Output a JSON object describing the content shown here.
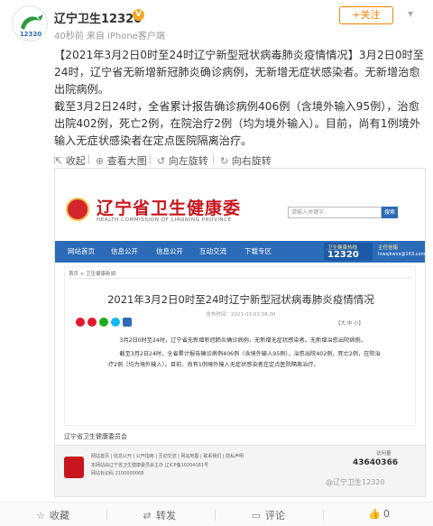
{
  "post": {
    "author": "辽宁卫生12320",
    "verified_mark": "V",
    "meta": "40秒前 来自 iPhone客户端",
    "follow_label": "+关注",
    "more_icon": "chevron-down-icon",
    "text_paragraph_1": "【2021年3月2日0时至24时辽宁新型冠状病毒肺炎疫情情况】3月2日0时至24时，辽宁省无新增新冠肺炎确诊病例，无新增无症状感染者。无新增治愈出院病例。",
    "text_paragraph_2": "截至3月2日24时，全省累计报告确诊病例406例（含境外输入95例），治愈出院402例，死亡2例，在院治疗2例（均为境外输入）。目前，尚有1例境外输入无症状感染者在定点医院隔离治疗。"
  },
  "image_toolbar": {
    "collapse": "收起",
    "view_large": "查看大图",
    "rotate_left": "向左旋转",
    "rotate_right": "向右旋转"
  },
  "screenshot": {
    "avatar_label": "12320",
    "site_title": "辽宁省卫生健康委",
    "site_subtitle": "HEALTH COMMISSION OF LIAONING PROVINCE",
    "search_placeholder": "请输入关键字",
    "search_button": "搜索",
    "nav": [
      "网站首页",
      "信息公开",
      "信息公开",
      "互动交流",
      "下载专区"
    ],
    "hotline_label": "卫生健康热线",
    "hotline_number": "12320",
    "mailbox_label": "主任信箱",
    "mailbox_addr": "lnwsjkwxx@163.com",
    "breadcrumb": "首页 > 卫生健康新闻",
    "article_title": "2021年3月2日0时至24时辽宁新型冠状病毒肺炎疫情情况",
    "article_meta": "发布时间：2021-03-03 08:00",
    "font_size_ctrl": "【大 中 小】",
    "article_p1": "3月2日0时至24时，辽宁省无新增新冠肺炎确诊病例，无新增无症状感染者。无新增治愈出院病例。",
    "article_p2": "截至3月2日24时，全省累计报告确诊病例406例（含境外输入95例），治愈出院402例，死亡2例，在院治疗2例（均为境外输入）。目前，尚有1例境外输入无症状感染者在定点医院隔离治疗。",
    "footer_title": "辽宁省卫生健康委员会",
    "footer_links": "网站首页 | 信息公开 | 公开指南 | 互动交流 | 网站地图 | 联系我们 | 隐私声明",
    "footer_line2": "本网站由辽宁省卫生健康委员会主办 辽ICP备10204181号",
    "footer_line3": "网站标识码 2100000068",
    "visit_label": "访问量",
    "visit_count": "43640366",
    "watermark": "@辽宁卫生12320"
  },
  "actions": {
    "favorite": "收藏",
    "repost": "转发",
    "comment": "评论",
    "like_count": "0"
  },
  "colors": {
    "accent_orange": "#ff8200",
    "site_red": "#c8161d",
    "nav_blue": "#2c6bb7"
  }
}
